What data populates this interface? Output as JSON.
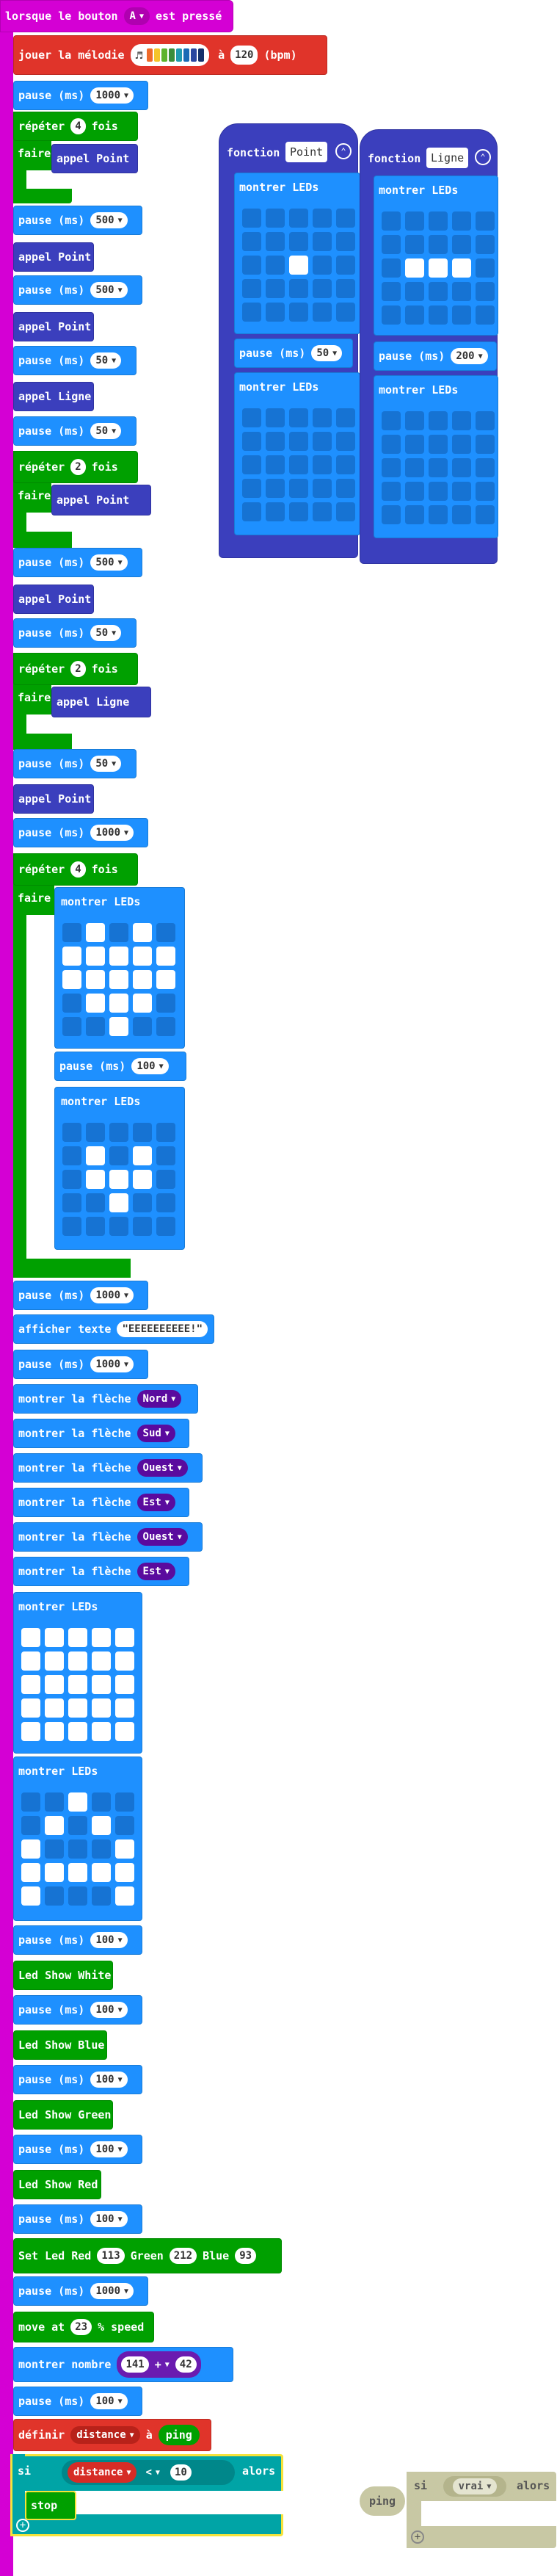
{
  "colors": {
    "event": "#d400d4",
    "basic": "#1e90ff",
    "loops": "#00a000",
    "functions": "#3b3fbd",
    "music": "#e0342a",
    "logic": "#00a4a6",
    "led_off": "#1673d3",
    "led_on": "#ffffff",
    "arrow_dd": "#5a0b9e"
  },
  "event": {
    "text1": "lorsque le bouton",
    "button": "A",
    "text2": "est pressé"
  },
  "melody": {
    "text": "jouer la mélodie",
    "tempo_prefix": "à",
    "tempo": "120",
    "unit": "(bpm)"
  },
  "kw": {
    "pause": "pause (ms)",
    "repeat": "répéter",
    "times": "fois",
    "do": "faire",
    "show_leds": "montrer LEDs",
    "call_point": "appel Point",
    "call_line": "appel Ligne",
    "function": "fonction",
    "show_text": "afficher texte",
    "show_arrow": "montrer la flèche",
    "show_number": "montrer nombre",
    "set_var": "définir",
    "to": "à",
    "if": "si",
    "then": "alors",
    "stop": "stop",
    "ping": "ping",
    "true": "vrai"
  },
  "values": {
    "p1000": "1000",
    "p500": "500",
    "p50": "50",
    "p100": "100",
    "p200": "200",
    "r4": "4",
    "r2": "2"
  },
  "functions": {
    "point": "Point",
    "line": "Ligne"
  },
  "text_value": "\"EEEEEEEEEE!\"",
  "arrows": [
    "Nord",
    "Sud",
    "Ouest",
    "Est",
    "Ouest",
    "Est"
  ],
  "leds": {
    "blank": [
      0,
      0,
      0,
      0,
      0,
      0,
      0,
      0,
      0,
      0,
      0,
      0,
      0,
      0,
      0,
      0,
      0,
      0,
      0,
      0,
      0,
      0,
      0,
      0,
      0
    ],
    "point": [
      0,
      0,
      0,
      0,
      0,
      0,
      0,
      0,
      0,
      0,
      0,
      0,
      1,
      0,
      0,
      0,
      0,
      0,
      0,
      0,
      0,
      0,
      0,
      0,
      0
    ],
    "line": [
      0,
      0,
      0,
      0,
      0,
      0,
      0,
      0,
      0,
      0,
      0,
      1,
      1,
      1,
      0,
      0,
      0,
      0,
      0,
      0,
      0,
      0,
      0,
      0,
      0
    ],
    "heart": [
      0,
      1,
      0,
      1,
      0,
      1,
      1,
      1,
      1,
      1,
      1,
      1,
      1,
      1,
      1,
      0,
      1,
      1,
      1,
      0,
      0,
      0,
      1,
      0,
      0
    ],
    "small_heart": [
      0,
      0,
      0,
      0,
      0,
      0,
      1,
      0,
      1,
      0,
      0,
      1,
      1,
      1,
      0,
      0,
      0,
      1,
      0,
      0,
      0,
      0,
      0,
      0,
      0
    ],
    "full": [
      1,
      1,
      1,
      1,
      1,
      1,
      1,
      1,
      1,
      1,
      1,
      1,
      1,
      1,
      1,
      1,
      1,
      1,
      1,
      1,
      1,
      1,
      1,
      1,
      1
    ],
    "house": [
      0,
      0,
      1,
      0,
      0,
      0,
      1,
      0,
      1,
      0,
      1,
      0,
      0,
      0,
      1,
      1,
      1,
      1,
      1,
      1,
      1,
      0,
      0,
      0,
      1
    ]
  },
  "ext": {
    "white": "Led Show White",
    "blue": "Led Show Blue",
    "green": "Led Show Green",
    "red": "Led Show Red",
    "set_led": "Set Led Red",
    "red_val": "113",
    "green_lbl": "Green",
    "green_val": "212",
    "blue_lbl": "Blue",
    "blue_val": "93",
    "move": "move at",
    "speed": "23",
    "speed_unit": "% speed"
  },
  "number": {
    "a": "141",
    "op": "+",
    "b": "42"
  },
  "variable": {
    "name": "distance",
    "cmp": "<",
    "value": "10"
  }
}
